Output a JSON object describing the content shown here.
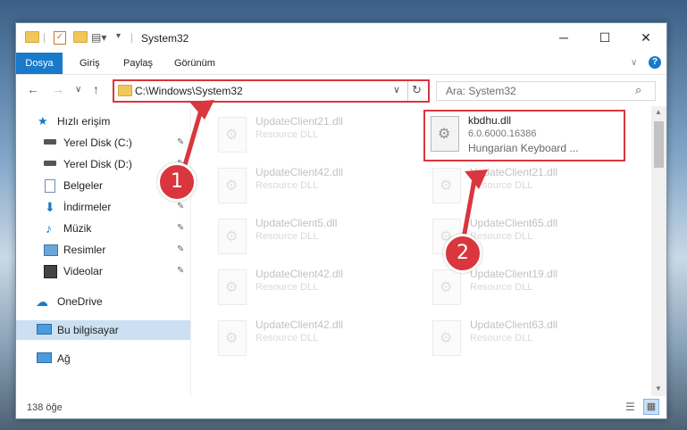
{
  "window": {
    "title": "System32",
    "minimize_glyph": "─",
    "maximize_glyph": "☐",
    "close_glyph": "✕"
  },
  "ribbon": {
    "tabs": [
      "Dosya",
      "Giriş",
      "Paylaş",
      "Görünüm"
    ],
    "collapse_glyph": "∨",
    "help_glyph": "?"
  },
  "nav": {
    "back_glyph": "←",
    "forward_glyph": "→",
    "recent_glyph": "∨",
    "up_glyph": "↑",
    "address": "C:\\Windows\\System32",
    "address_dropdown_glyph": "∨",
    "refresh_glyph": "↻",
    "search_placeholder": "Ara: System32",
    "search_glyph": "⌕"
  },
  "sidebar": {
    "items": [
      {
        "label": "Hızlı erişim",
        "icon": "star-icon",
        "pinned": false
      },
      {
        "label": "Yerel Disk (C:)",
        "icon": "drive-icon",
        "pinned": true
      },
      {
        "label": "Yerel Disk (D:)",
        "icon": "drive-icon",
        "pinned": true
      },
      {
        "label": "Belgeler",
        "icon": "document-icon",
        "pinned": true
      },
      {
        "label": "İndirmeler",
        "icon": "download-icon",
        "pinned": true
      },
      {
        "label": "Müzik",
        "icon": "music-icon",
        "pinned": true
      },
      {
        "label": "Resimler",
        "icon": "pictures-icon",
        "pinned": true
      },
      {
        "label": "Videolar",
        "icon": "video-icon",
        "pinned": true
      },
      {
        "label": "OneDrive",
        "icon": "cloud-icon",
        "pinned": false
      },
      {
        "label": "Bu bilgisayar",
        "icon": "computer-icon",
        "pinned": false
      },
      {
        "label": "Ağ",
        "icon": "network-icon",
        "pinned": false
      }
    ],
    "pin_glyph": "📌"
  },
  "files": [
    {
      "name": "UpdateClient21.dll",
      "desc": "Resource DLL"
    },
    {
      "name": "kbdhu.dll",
      "desc": "6.0.6000.16386",
      "desc2": "Hungarian Keyboard ..."
    },
    {
      "name": "UpdateClient42.dll",
      "desc": "Resource DLL"
    },
    {
      "name": "UpdateClient21.dll",
      "desc": "Resource DLL"
    },
    {
      "name": "UpdateClient5.dll",
      "desc": "Resource DLL"
    },
    {
      "name": "UpdateClient65.dll",
      "desc": "Resource DLL"
    },
    {
      "name": "UpdateClient42.dll",
      "desc": "Resource DLL"
    },
    {
      "name": "UpdateClient19.dll",
      "desc": "Resource DLL"
    },
    {
      "name": "UpdateClient42.dll",
      "desc": "Resource DLL"
    },
    {
      "name": "UpdateClient63.dll",
      "desc": "Resource DLL"
    }
  ],
  "status": {
    "count": "138 öğe",
    "details_view_glyph": "☰",
    "tiles_view_glyph": "▦"
  },
  "callouts": [
    "1",
    "2"
  ],
  "colors": {
    "accent": "#1979ca",
    "highlight_red": "#d9363e",
    "selected_bg": "#cce0f3"
  }
}
